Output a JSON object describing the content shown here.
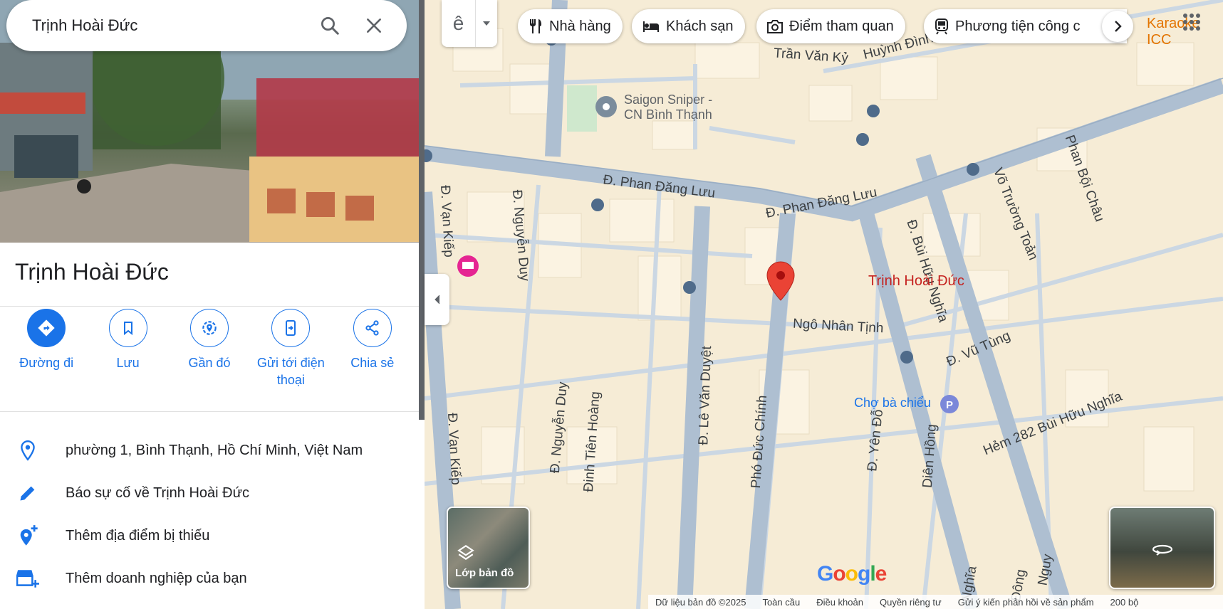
{
  "search": {
    "query": "Trịnh Hoài Đức"
  },
  "place": {
    "title": "Trịnh Hoài Đức"
  },
  "actions": [
    {
      "label": "Đường đi"
    },
    {
      "label": "Lưu"
    },
    {
      "label": "Gần đó"
    },
    {
      "label": "Gửi tới điện thoại"
    },
    {
      "label": "Chia sẻ"
    }
  ],
  "info": {
    "address": "phường 1, Bình Thạnh, Hồ Chí Minh, Việt Nam",
    "report": "Báo sự cố về Trịnh Hoài Đức",
    "add_place": "Thêm địa điểm bị thiếu",
    "add_business": "Thêm doanh nghiệp của bạn"
  },
  "map": {
    "layer_glyph": "ê",
    "chips": [
      "Nhà hàng",
      "Khách sạn",
      "Điểm tham quan",
      "Phương tiện công c"
    ],
    "karaoke": "Karaoke ICC",
    "pin_label": "Trịnh Hoài Đức",
    "poi_sniper": "Saigon Sniper -",
    "poi_sniper2": "CN Bình Thạnh",
    "poi_cho": "Chợ bà chiểu",
    "roads": {
      "phan_dang_luu_1": "Đ. Phan Đăng Lưu",
      "phan_dang_luu_2": "Đ. Phan Đăng Lưu",
      "tran_van_ky": "Trần Văn Kỷ",
      "huynh": "Huỳnh Đình",
      "van_kiep_1": "Đ. Vạn Kiếp",
      "van_kiep_2": "Đ. Vạn Kiếp",
      "nguyen_duy_1": "Đ. Nguyễn Duy",
      "nguyen_duy_2": "Đ. Nguyễn Duy",
      "dinh_tien_hoang": "Đinh Tiên Hoàng",
      "le_van_duyet": "Đ. Lê Văn Duyệt",
      "pho_duc_chinh": "Phó Đức Chính",
      "ngo_nhan_tinh": "Ngô Nhân Tịnh",
      "bui_huu_nghia": "Đ. Bùi Hữu Nghĩa",
      "vo_truong_toan": "Võ Trường Toản",
      "phan_boi_chau": "Phan Bội Châu",
      "vu_tung": "Đ. Vũ Tùng",
      "hem_282": "Hẻm 282 Bùi Hữu Nghĩa",
      "yen_do": "Đ. Yên Đỗ",
      "dien_hong": "Diên Hồng",
      "nghia": "Nghĩa",
      "dong": "Đông",
      "nguy": "Nguy"
    },
    "layer_thumb": "Lớp bản đồ",
    "google": "Google"
  },
  "footer": {
    "data": "Dữ liệu bản đồ ©2025",
    "global": "Toàn cầu",
    "terms": "Điều khoản",
    "privacy": "Quyền riêng tư",
    "feedback": "Gửi ý kiến phản hồi về sản phẩm",
    "scale": "200 bộ"
  },
  "colors": {
    "accent": "#1a73e8",
    "pin": "#ea4335",
    "road": "#aebfd1",
    "map_bg": "#f6ecd6"
  }
}
